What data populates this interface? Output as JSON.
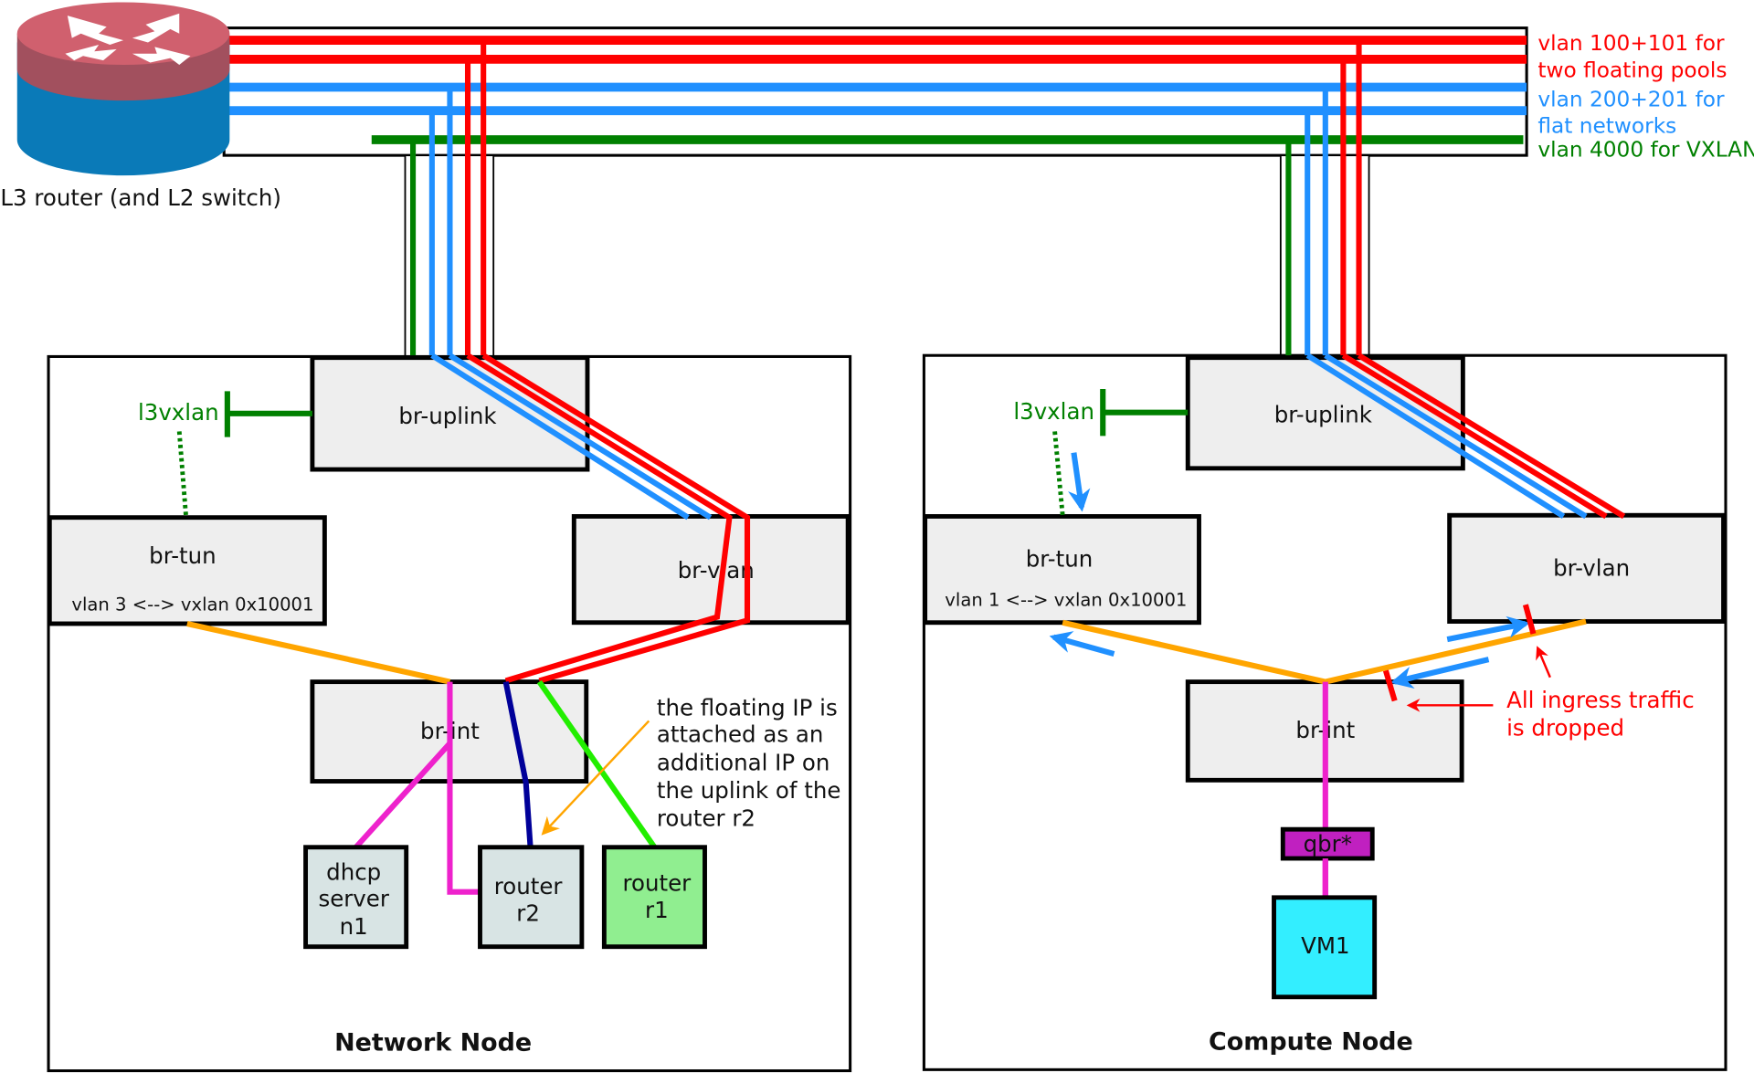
{
  "router": {
    "label": "L3 router (and L2 switch)"
  },
  "legend": {
    "red_line1": "vlan 100+101 for",
    "red_line2": "two floating pools",
    "blue_line1": "vlan 200+201 for",
    "blue_line2": "flat networks",
    "green_line": "vlan 4000 for VXLAN"
  },
  "colors": {
    "floating": "#ff0000",
    "flat": "#2090ff",
    "vxlan": "#008000",
    "orange": "#ffa500",
    "magenta": "#ee22cc",
    "navy": "#000099",
    "lime": "#22ee00"
  },
  "network_node": {
    "title": "Network Node",
    "br_uplink": "br-uplink",
    "l3vxlan": "l3vxlan",
    "br_tun": "br-tun",
    "br_tun_map": "vlan 3 <--> vxlan 0x10001",
    "br_vlan": "br-vlan",
    "br_int": "br-int",
    "dhcp": [
      "dhcp",
      "server",
      "n1"
    ],
    "router_r2": [
      "router",
      "r2"
    ],
    "router_r1": [
      "router",
      "r1"
    ],
    "annotation": [
      "the floating IP is",
      "attached as an",
      "additional IP on",
      "the uplink of the",
      "router r2"
    ]
  },
  "compute_node": {
    "title": "Compute Node",
    "br_uplink": "br-uplink",
    "l3vxlan": "l3vxlan",
    "br_tun": "br-tun",
    "br_tun_map": "vlan 1 <--> vxlan 0x10001",
    "br_vlan": "br-vlan",
    "br_int": "br-int",
    "qbr": "qbr*",
    "vm": "VM1",
    "annotation": [
      "All ingress traffic",
      "is dropped"
    ]
  }
}
